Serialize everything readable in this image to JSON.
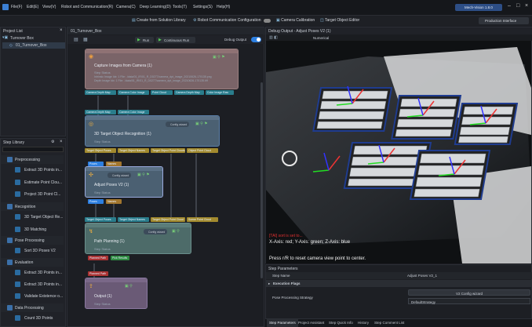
{
  "menu": {
    "items": [
      "File(F)",
      "Edit(E)",
      "View(V)",
      "Robot and Communication(R)",
      "Camera(C)",
      "Deep Learning(D)",
      "Tools(T)",
      "Settings(S)",
      "Help(H)"
    ],
    "user": "Mech-Vision 1.8.0"
  },
  "toolbar": {
    "create_solution": "Create from Solution Library",
    "robot_comm": "Robot Communication Configuration",
    "camera_calibration": "Camera Calibration",
    "target_object_editor": "Target Object Editor",
    "production_interface": "Production Interface"
  },
  "project_list": {
    "title": "Project List",
    "solution": "Turnover Box",
    "project": "01_Turnover_Box"
  },
  "canvas": {
    "tab": "01_Turnover_Box",
    "run": "Run",
    "continuous_run": "Continuous Run",
    "debug_output": "Debug Output"
  },
  "nodes": [
    {
      "name": "Capture Images from Camera (1)",
      "status": "Step Status",
      "detail1": "Intrinsic Image Idx: 1 File: ./data/01_IR/01_R_D0277/camera_dpt_image_20210626-170135.png",
      "detail2": "Depth Image Idx: 1 File: ./data/01_IR/01_R_D0277/camera_dpt_image_20210626-170135.tiff"
    },
    {
      "name": "3D Target Object Recognition (1)",
      "status": "Step Status",
      "config": "Config wizard"
    },
    {
      "name": "Adjust Poses V2 (1)",
      "status": "Step Status",
      "config": "Config wizard"
    },
    {
      "name": "Path Planning (1)",
      "status": "Step Status",
      "config": "Config wizard"
    },
    {
      "name": "Output (1)",
      "status": "Step Status"
    }
  ],
  "ports": {
    "capture_out": [
      "Camera Depth Map",
      "Camera Color Image",
      "Point Cloud",
      "Camera Depth Map",
      "Color Image Raw"
    ],
    "capture_to_recog": [
      "Camera Depth Map",
      "Camera Color Image"
    ],
    "recog_out": [
      "Target Object Poses",
      "Target Object Names",
      "Target Object Point Clouds",
      "Object Point Cloud"
    ],
    "recog_to_adjust": [
      "Poses",
      "Names"
    ],
    "adjust_out": [
      "Poses",
      "Names"
    ],
    "path_in": [
      "Target Object Poses",
      "Target Object Names",
      "Target Object Point Cloud",
      "Scene Point Cloud"
    ],
    "path_out": [
      "Planned Path",
      "Pick Results"
    ],
    "output_in": [
      "Planned Path"
    ]
  },
  "step_library": {
    "title": "Step Library",
    "categories": [
      {
        "label": "Preprocessing",
        "items": [
          "Extract 3D Points in...",
          "Estimate Point Clou...",
          "Project 3D Point Cl..."
        ]
      },
      {
        "label": "Recognition",
        "items": [
          "3D Target Object Re...",
          "3D Matching"
        ]
      },
      {
        "label": "Pose Processing",
        "items": [
          "Sort 3D Poses V2"
        ]
      },
      {
        "label": "Evaluation",
        "items": [
          "Extract 3D Points in...",
          "Extract 3D Points in...",
          "Validate Existence o..."
        ]
      },
      {
        "label": "Data Processing",
        "items": [
          "Count 3D Points"
        ]
      }
    ]
  },
  "debug": {
    "title": "Debug Output - Adjust Poses V2 (1)",
    "numerical": "Numerical",
    "warning": "[TAI] sort is set to...",
    "axis_hint": "X-Axis: red; Y-Axis: green; Z-Axis: blue",
    "reset_hint": "Press r/R to reset camera view point to center."
  },
  "step_params": {
    "title": "Step Parameters",
    "step_name_label": "Step Name",
    "step_name_value": "Adjust Poses V2_1",
    "execution_flags": "Execution Flags",
    "config_wizard": "V2 Config wizard",
    "post_strategy_label": "Pose Processing Strategy",
    "post_strategy_value": "DefaultStrategy"
  },
  "bottom_tabs": [
    "Step Parameters",
    "Project Assistant",
    "Step Quick Info",
    "History",
    "Step Comment List"
  ],
  "colors": {
    "accent": "#2d7fe0",
    "node_blue": "#4b6072",
    "capture": "#7a6468",
    "port_cyan": "#2a7d8c",
    "port_yellow": "#a28a2e",
    "port_red": "#a33",
    "port_green": "#2f8a42"
  }
}
